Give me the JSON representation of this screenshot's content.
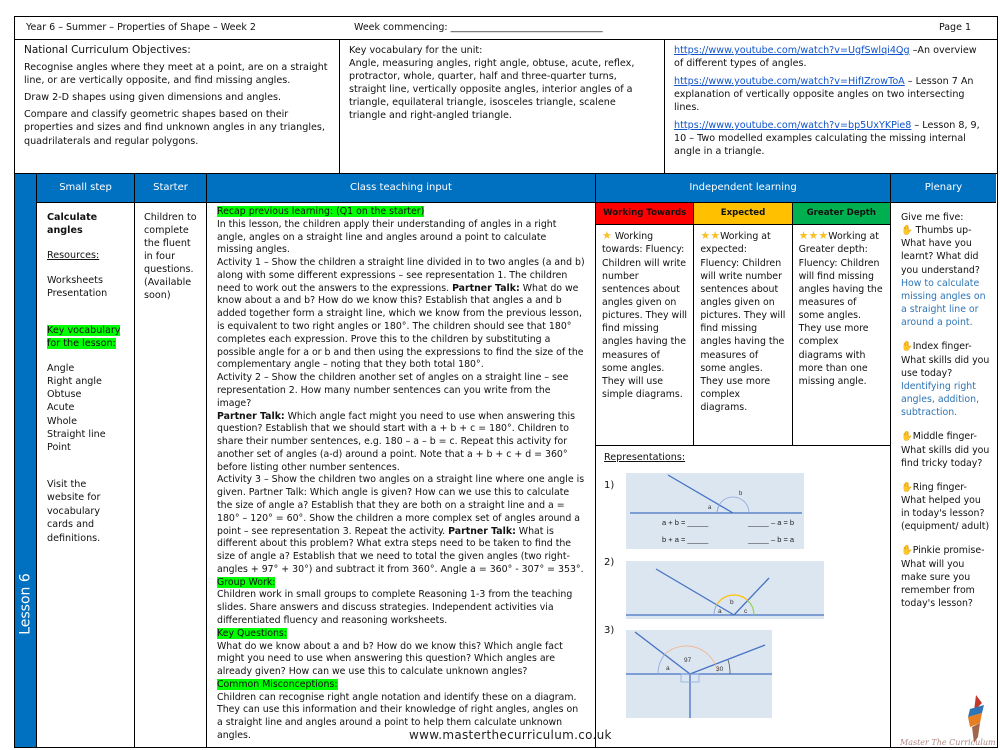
{
  "header": {
    "title": "Year 6 – Summer – Properties of Shape – Week 2",
    "week_commencing": "Week commencing: ________________________________",
    "page": "Page 1"
  },
  "objectives": {
    "title": "National Curriculum Objectives:",
    "items": [
      "Recognise angles where they meet at a point, are on a straight line, or are vertically opposite, and find missing angles.",
      "Draw 2-D shapes using given dimensions and angles.",
      "Compare and classify geometric shapes based on their properties and sizes and find unknown angles in any triangles, quadrilaterals and regular polygons."
    ]
  },
  "vocabulary": {
    "title": "Key vocabulary for the unit:",
    "text": "Angle, measuring angles, right angle, obtuse, acute, reflex, protractor, whole, quarter, half and three-quarter turns, straight line, vertically opposite angles, interior angles of a triangle, equilateral triangle, isosceles triangle, scalene triangle and right-angled triangle."
  },
  "links": [
    {
      "url": "https://www.youtube.com/watch?v=UgfSwlqi4Qg",
      "desc": " –An overview of different types of angles."
    },
    {
      "url": "https://www.youtube.com/watch?v=HifIZrowToA",
      "desc": " – Lesson 7 An explanation of vertically opposite angles on two intersecting lines."
    },
    {
      "url": "https://www.youtube.com/watch?v=bp5UxYKPie8",
      "desc": " – Lesson 8, 9, 10 – Two modelled examples calculating the missing internal angle in a triangle."
    }
  ],
  "lesson_label": "Lesson 6",
  "columns": {
    "small_step": "Small step",
    "starter": "Starter",
    "class_input": "Class teaching input",
    "independent": "Independent learning",
    "plenary": "Plenary"
  },
  "small_step": {
    "title": "Calculate angles",
    "resources_label": "Resources:",
    "resources": [
      "Worksheets",
      "Presentation"
    ],
    "key_vocab_label": "Key vocabulary for the lesson:",
    "vocab": [
      "Angle",
      "Right angle",
      "Obtuse",
      "Acute",
      "Whole",
      "Straight line",
      "Point"
    ],
    "visit": "Visit the website for vocabulary cards and definitions."
  },
  "starter": {
    "text": "Children to complete the fluent in four questions.",
    "note": "(Available soon)"
  },
  "class_input": {
    "recap": "Recap previous learning: (Q1 on the starter)",
    "intro": "In this lesson, the children apply their understanding of angles in a right angle, angles on a straight line and angles around a point to calculate missing angles.",
    "a1_pre": "Activity 1 – Show the children a straight line divided in to two angles (a and b) along with some different expressions – see representation 1. The children need to work out the answers to the expressions. ",
    "partner_talk": "Partner Talk:",
    "a1_post": " What do we know about a and b? How do we know this? Establish that angles a and b added together form a straight line, which we know from the previous lesson, is equivalent to two right angles or 180°. The children should see that 180° completes each expression. Prove this to the children by substituting a possible angle for a or b and then using the expressions to find the size of the complementary angle – noting that they both total 180°.",
    "a2_pre": "Activity 2 – Show the children another set of angles on a straight line – see representation 2. How many number sentences can you write from the image?",
    "a2_post": " Which angle fact might you need to use when answering this question? Establish that we should start with a + b + c = 180°. Children to share their number sentences, e.g. 180 – a – b = c. Repeat this activity for another set of angles (a-d) around a point. Note that a + b + c + d = 360° before listing other number sentences.",
    "a3_pre": "Activity 3 – Show the children two angles on a straight line where one angle is given. Partner Talk: Which angle is given? How can we use this to calculate the size of angle a? Establish that they are both on a straight line and a = 180° – 120° = 60°. Show the children a more complex set of angles around a point – see representation 3. Repeat the activity. ",
    "a3_post": " What is different about this problem? What extra steps need to be taken to find the size of angle a? Establish that we need to total the given angles (two right-angles + 97° + 30°) and subtract it from 360°. Angle a = 360° - 307° = 353°.",
    "group_work_label": "Group Work:",
    "group_work": "Children work in small groups to complete Reasoning 1-3 from the teaching slides. Share answers and discuss strategies. Independent activities via differentiated fluency and reasoning worksheets.",
    "key_questions_label": "Key Questions:",
    "key_questions": "What do we know about a and b? How do we know this? Which angle fact might you need to use when answering this question? Which angles are already given? How can we use this to calculate unknown angles?",
    "misconceptions_label": "Common Misconceptions:",
    "misconceptions": "Children can recognise right angle notation and identify these on a diagram. They can use this information and their knowledge of right angles, angles on a straight line and angles around a point to help them calculate unknown angles."
  },
  "independent": {
    "levels": [
      {
        "label": "Working Towards",
        "color": "#ff0000",
        "stars": "★",
        "text": " Working towards: Fluency: Children will write number sentences about angles given on pictures. They will find missing angles having the measures of some angles. They will use simple diagrams."
      },
      {
        "label": "Expected",
        "color": "#ffc000",
        "stars": "★★",
        "text": "Working at expected: Fluency: Children will write number sentences about angles given on pictures. They will find missing angles having the measures of some angles. They use more complex diagrams."
      },
      {
        "label": "Greater Depth",
        "color": "#00b050",
        "stars": "★★★",
        "text": "Working at Greater depth: Fluency: Children will find missing angles having the measures of some angles. They use more complex diagrams with more than one missing angle."
      }
    ],
    "representations_label": "Representations:",
    "rep_numbers": [
      "1)",
      "2)",
      "3)"
    ],
    "rep1": {
      "angle_labels": [
        "a",
        "b"
      ],
      "equations": [
        "a + b = _____",
        "_____ – a = b",
        "b + a = _____",
        "_____ – b = a"
      ]
    },
    "rep2": {
      "angle_labels": [
        "a",
        "b",
        "c"
      ]
    },
    "rep3": {
      "angle_labels": [
        "a",
        "97",
        "30"
      ]
    }
  },
  "plenary": {
    "intro": "Give me five:",
    "items": [
      {
        "finger": " Thumbs up-",
        "question": "What have you learnt? What did you understand?",
        "answer": "How to calculate missing angles on a straight line or around a point."
      },
      {
        "finger": "Index finger-",
        "question": "What skills did you use today?",
        "answer": "Identifying right angles, addition, subtraction."
      },
      {
        "finger": "Middle finger-",
        "question": "What skills did you find tricky today?",
        "answer": ""
      },
      {
        "finger": "Ring finger-",
        "question": "What helped you in today's lesson? (equipment/ adult)",
        "answer": ""
      },
      {
        "finger": "Pinkie promise-",
        "question": "What will you make sure you remember from today's lesson?",
        "answer": ""
      }
    ]
  },
  "footer": {
    "url": "www.masterthecurriculum.co.uk",
    "brand": "Master The Curriculum"
  },
  "colors": {
    "header_blue": "#0070c0",
    "highlight_green": "#00ff00",
    "working_towards": "#ff0000",
    "expected": "#ffc000",
    "greater_depth": "#00b050",
    "link_blue": "#1155cc",
    "plenary_answer_blue": "#2e75b6"
  }
}
